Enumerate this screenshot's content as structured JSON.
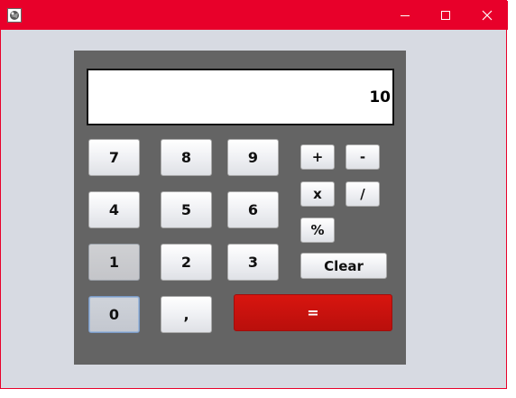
{
  "window": {
    "title": "",
    "controls": {
      "minimize": "—",
      "maximize": "☐",
      "close": "✕"
    }
  },
  "display": {
    "value": "10"
  },
  "digits": {
    "seven": "7",
    "eight": "8",
    "nine": "9",
    "four": "4",
    "five": "5",
    "six": "6",
    "one": "1",
    "two": "2",
    "three": "3",
    "zero": "0",
    "comma": ","
  },
  "operators": {
    "plus": "+",
    "minus": "-",
    "multiply": "x",
    "divide": "/",
    "percent": "%",
    "clear": "Clear",
    "equals": "="
  },
  "colors": {
    "title_bar": "#e8002a",
    "window_bg": "#d7dae2",
    "panel_bg": "#646464",
    "equals_bg": "#c8120e"
  }
}
